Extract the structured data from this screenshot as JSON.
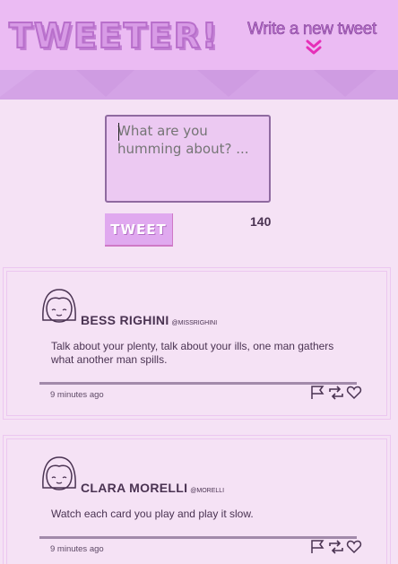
{
  "header": {
    "logo": "TWEETER!",
    "compose_link": "Write a new tweet",
    "chevron_icon": "double-chevron-down-icon"
  },
  "compose": {
    "placeholder": "What are you humming about? ...",
    "button_label": "TWEET",
    "counter": "140"
  },
  "tweets": [
    {
      "name": "BESS RIGHINI",
      "handle": "@MISSRIGHINI",
      "text": "Talk about your plenty, talk about your ills, one man gathers what another man spills.",
      "time": "9 minutes ago"
    },
    {
      "name": "CLARA MORELLI",
      "handle": "@MORELLI",
      "text": "Watch each card you play and play it slow.",
      "time": "9 minutes ago"
    }
  ],
  "colors": {
    "header_bg": "#ebbbf3",
    "band_bg": "#d4a3e6",
    "page_bg": "#f5e2f5",
    "accent": "#e62fb8"
  }
}
